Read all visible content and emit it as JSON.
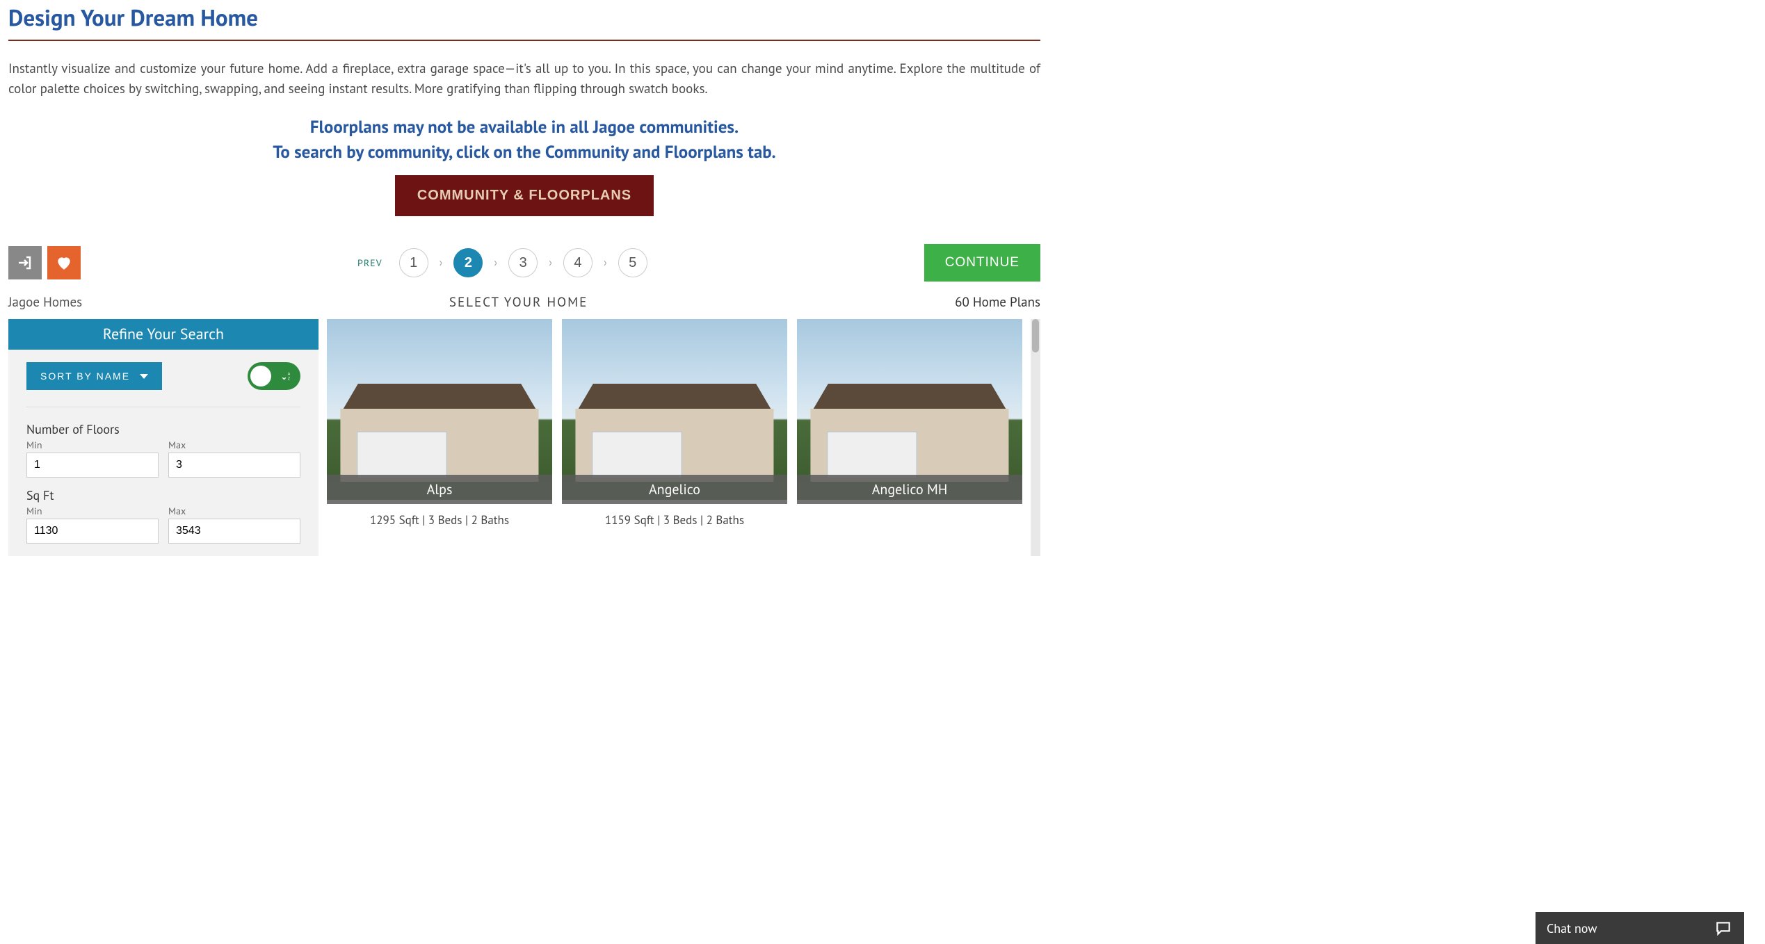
{
  "header": {
    "title": "Design Your Dream Home",
    "intro": "Instantly visualize and customize your future home. Add a fireplace, extra garage space—it's all up to you. In this space, you can change your mind anytime. Explore the multitude of color palette choices by switching, swapping, and seeing instant results. More gratifying than flipping through swatch books.",
    "subhead1": "Floorplans may not be available in all Jagoe communities.",
    "subhead2": "To search by community, click on the Community and Floorplans tab.",
    "cta": "COMMUNITY & FLOORPLANS"
  },
  "stepper": {
    "prev": "PREV",
    "steps": [
      "1",
      "2",
      "3",
      "4",
      "5"
    ],
    "active_index": 1,
    "continue": "CONTINUE"
  },
  "labels": {
    "left": "Jagoe Homes",
    "mid": "SELECT YOUR HOME",
    "right": "60 Home Plans"
  },
  "sidebar": {
    "refine": "Refine Your Search",
    "sort_label": "SORT BY NAME",
    "filter_floors_label": "Number of Floors",
    "min_label": "Min",
    "max_label": "Max",
    "floors_min": "1",
    "floors_max": "3",
    "filter_sqft_label": "Sq Ft",
    "sqft_min": "1130",
    "sqft_max": "3543"
  },
  "cards": [
    {
      "name": "Alps",
      "meta": "1295 Sqft | 3 Beds | 2 Baths"
    },
    {
      "name": "Angelico",
      "meta": "1159 Sqft | 3 Beds | 2 Baths"
    },
    {
      "name": "Angelico MH",
      "meta": ""
    }
  ],
  "chat": {
    "label": "Chat now"
  }
}
